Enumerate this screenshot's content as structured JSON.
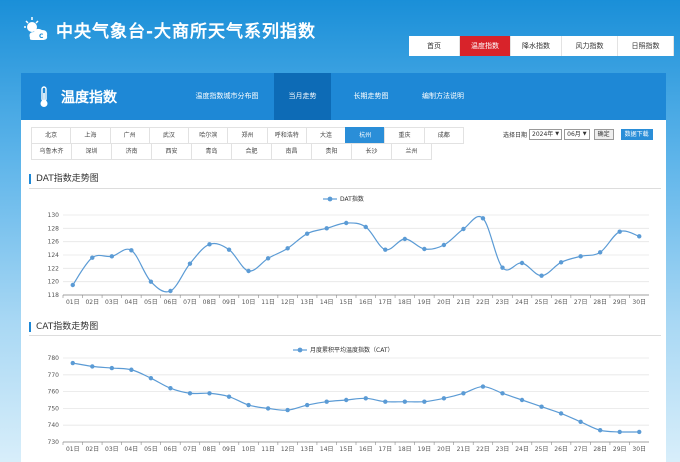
{
  "site": {
    "title": "中央气象台-大商所天气系列指数"
  },
  "nav": [
    {
      "label": "首页",
      "active": false
    },
    {
      "label": "温度指数",
      "active": true
    },
    {
      "label": "降水指数",
      "active": false
    },
    {
      "label": "风力指数",
      "active": false
    },
    {
      "label": "日照指数",
      "active": false
    }
  ],
  "panel": {
    "title": "温度指数",
    "tabs": [
      {
        "label": "温度指数城市分布图",
        "active": false
      },
      {
        "label": "当月走势",
        "active": true
      },
      {
        "label": "长期走势图",
        "active": false
      },
      {
        "label": "编制方法说明",
        "active": false
      }
    ]
  },
  "cities": {
    "row1": [
      "北京",
      "上海",
      "广州",
      "武汉",
      "哈尔滨",
      "郑州",
      "呼和浩特",
      "大连",
      "杭州",
      "重庆",
      "成都"
    ],
    "row2": [
      "乌鲁木齐",
      "深圳",
      "济南",
      "西安",
      "青岛",
      "合肥",
      "南昌",
      "贵阳",
      "长沙",
      "兰州"
    ],
    "active": "杭州"
  },
  "datebar": {
    "label": "选择日期",
    "year": "2024年",
    "month": "06月",
    "confirm": "确定",
    "download": "数据下载"
  },
  "sections": {
    "dat": "DAT指数走势图",
    "cat": "CAT指数走势图"
  },
  "colors": {
    "line": "#5b9bd5",
    "accent": "#1e88d6",
    "active_nav": "#d8232a"
  },
  "chart_data": [
    {
      "type": "line",
      "legend": "DAT指数",
      "categories": [
        "01日",
        "02日",
        "03日",
        "04日",
        "05日",
        "06日",
        "07日",
        "08日",
        "09日",
        "10日",
        "11日",
        "12日",
        "13日",
        "14日",
        "15日",
        "16日",
        "17日",
        "18日",
        "19日",
        "20日",
        "21日",
        "22日",
        "23日",
        "24日",
        "25日",
        "26日",
        "27日",
        "28日",
        "29日",
        "30日"
      ],
      "values": [
        119.5,
        123.6,
        123.8,
        124.7,
        120.0,
        118.6,
        122.7,
        125.6,
        124.8,
        121.6,
        123.5,
        125.0,
        127.2,
        128.0,
        128.8,
        128.2,
        124.8,
        126.4,
        124.9,
        125.5,
        127.9,
        129.5,
        122.1,
        122.8,
        120.9,
        122.9,
        123.8,
        124.4,
        127.5,
        126.8
      ],
      "ylim": [
        118,
        130
      ],
      "yticks": [
        118,
        120,
        122,
        124,
        126,
        128,
        130
      ],
      "grid": true,
      "legend_position": "top-center"
    },
    {
      "type": "line",
      "legend": "月度累积平均温度指数（CAT）",
      "categories": [
        "01日",
        "02日",
        "03日",
        "04日",
        "05日",
        "06日",
        "07日",
        "08日",
        "09日",
        "10日",
        "11日",
        "12日",
        "13日",
        "14日",
        "15日",
        "16日",
        "17日",
        "18日",
        "19日",
        "20日",
        "21日",
        "22日",
        "23日",
        "24日",
        "25日",
        "26日",
        "27日",
        "28日",
        "29日",
        "30日"
      ],
      "values": [
        777,
        775,
        774,
        773,
        768,
        762,
        759,
        759,
        757,
        752,
        750,
        749,
        752,
        754,
        755,
        756,
        754,
        754,
        754,
        756,
        759,
        763,
        759,
        755,
        751,
        747,
        742,
        737,
        736,
        736
      ],
      "ylim": [
        730,
        780
      ],
      "yticks": [
        730,
        740,
        750,
        760,
        770,
        780
      ],
      "grid": true,
      "legend_position": "top-center"
    }
  ]
}
